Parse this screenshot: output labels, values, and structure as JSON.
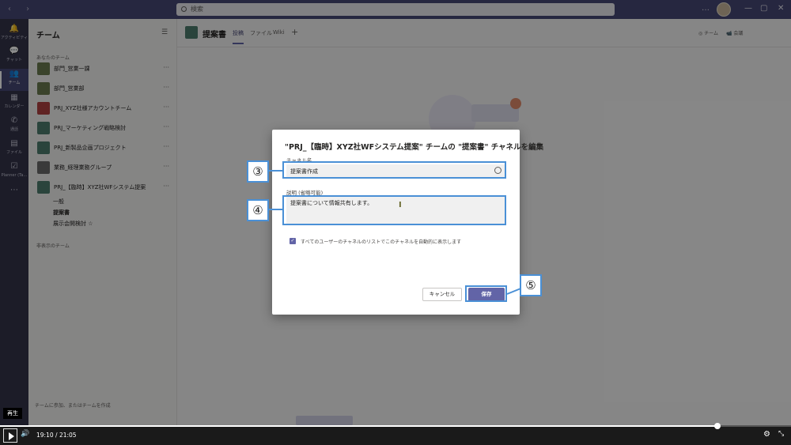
{
  "titlebar": {
    "search_placeholder": "検索",
    "more": "…"
  },
  "rail": {
    "items": [
      {
        "icon": "bell-icon",
        "glyph": "🔔",
        "label": "アクティビティ"
      },
      {
        "icon": "chat-icon",
        "glyph": "💬",
        "label": "チャット"
      },
      {
        "icon": "teams-icon",
        "glyph": "👥",
        "label": "チーム"
      },
      {
        "icon": "calendar-icon",
        "glyph": "▦",
        "label": "カレンダー"
      },
      {
        "icon": "phone-icon",
        "glyph": "✆",
        "label": "通話"
      },
      {
        "icon": "file-icon",
        "glyph": "▤",
        "label": "ファイル"
      },
      {
        "icon": "planner-icon",
        "glyph": "☑",
        "label": "Planner (Ta…"
      },
      {
        "icon": "more-apps-icon",
        "glyph": "⋯",
        "label": ""
      }
    ]
  },
  "teams_panel": {
    "title": "チーム",
    "section_mine": "あなたのチーム",
    "teams": [
      {
        "name": "部門_営業一課",
        "color": "olive"
      },
      {
        "name": "部門_営業部",
        "color": "olive"
      },
      {
        "name": "PRJ_XYZ社様アカウントチーム",
        "color": "red"
      },
      {
        "name": "PRJ_マーケティング戦略検討",
        "color": "teal"
      },
      {
        "name": "PRJ_新製品企画プロジェクト",
        "color": "teal"
      },
      {
        "name": "業務_経理業務グループ",
        "color": "gray"
      },
      {
        "name": "PRJ_【臨時】XYZ社WFシステム提案",
        "color": "teal"
      }
    ],
    "channels": [
      "一般",
      "提案書",
      "展示会開検討 ☆"
    ],
    "section_hidden": "非表示のチーム",
    "bottom_link": "チームに参加、またはチームを作成"
  },
  "channel_header": {
    "name": "提案書",
    "tabs": [
      "投稿",
      "ファイル",
      "Wiki"
    ],
    "add": "+",
    "team_btn": "◎ チーム",
    "meet_btn": "📹 会議"
  },
  "dialog": {
    "title": "\"PRJ_【臨時】XYZ社WFシステム提案\" チームの \"提案書\" チャネルを編集",
    "channel_name_label": "チャネル名",
    "channel_name_value": "提案書作成",
    "description_label": "説明 (省略可能)",
    "description_value": "提案書について情報共有します。",
    "checkbox_label": "すべてのユーザーのチャネルのリストでこのチャネルを自動的に表示します",
    "checkbox_checked": true,
    "cancel_label": "キャンセル",
    "save_label": "保存"
  },
  "annotations": {
    "badge_3": "③",
    "badge_4": "④",
    "badge_5": "⑤"
  },
  "player": {
    "tooltip": "再生",
    "current_time": "19:10",
    "separator": "/",
    "total_time": "21:05",
    "progress": 0.907
  },
  "colors": {
    "accent": "#6264a7",
    "titlebar": "#464775",
    "rail": "#33344a",
    "annotation": "#4a90d6"
  }
}
